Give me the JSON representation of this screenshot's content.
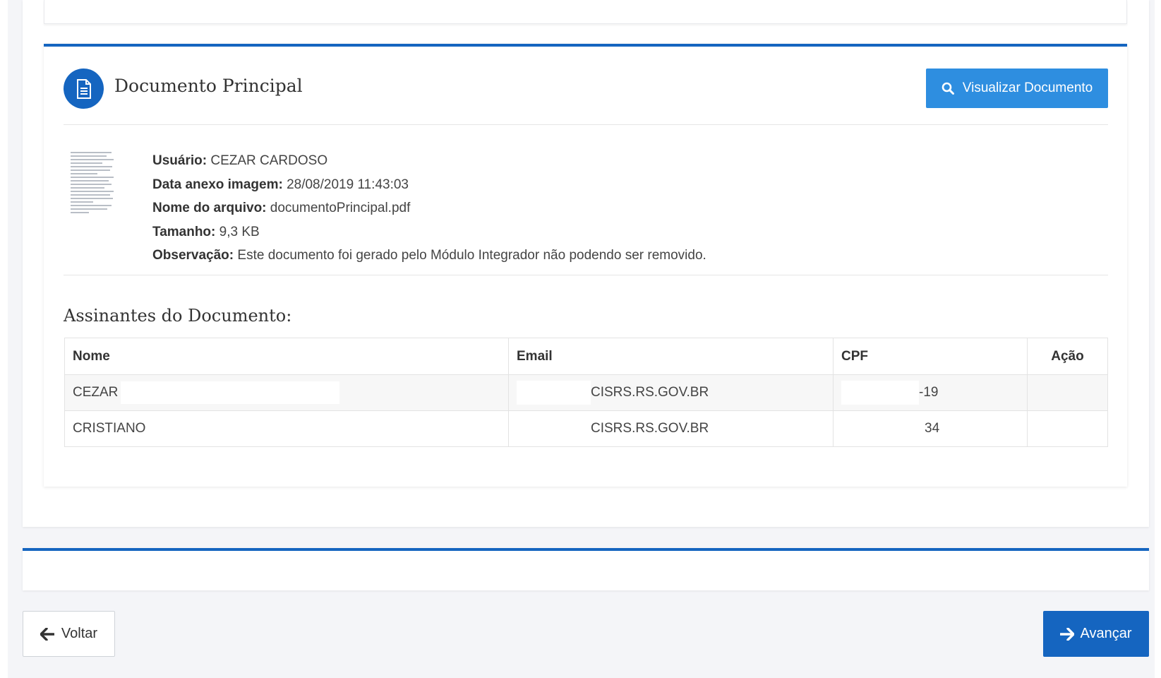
{
  "document": {
    "title": "Documento Principal",
    "view_button_label": "Visualizar Documento",
    "meta": [
      {
        "label": "Usuário:",
        "value": "CEZAR CARDOSO"
      },
      {
        "label": "Data anexo imagem:",
        "value": "28/08/2019 11:43:03"
      },
      {
        "label": "Nome do arquivo:",
        "value": "documentoPrincipal.pdf"
      },
      {
        "label": "Tamanho:",
        "value": "9,3 KB"
      },
      {
        "label": "Observação:",
        "value": "Este documento foi gerado pelo Módulo Integrador não podendo ser removido."
      }
    ]
  },
  "signers": {
    "title": "Assinantes do Documento:",
    "columns": [
      "Nome",
      "Email",
      "CPF",
      "Ação"
    ],
    "rows": [
      {
        "nome": "CEZAR",
        "email": "CISRS.RS.GOV.BR",
        "cpf": "-19",
        "acao": ""
      },
      {
        "nome": "CRISTIANO",
        "email": "CISRS.RS.GOV.BR",
        "cpf": "34",
        "acao": ""
      }
    ]
  },
  "navigation": {
    "back_label": "Voltar",
    "next_label": "Avançar"
  },
  "colors": {
    "primary": "#1565c0",
    "view_button": "#2e8ee0",
    "background": "#f4f5f8"
  },
  "icons": [
    "document-icon",
    "search-icon",
    "arrow-left-icon",
    "arrow-right-icon"
  ]
}
